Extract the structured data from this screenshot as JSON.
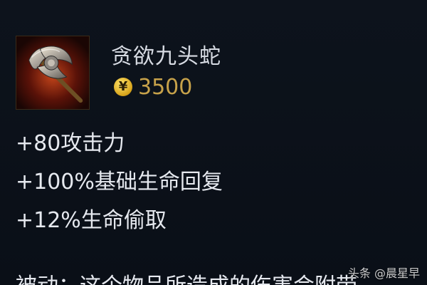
{
  "item": {
    "name": "贪欲九头蛇",
    "cost": "3500",
    "gold_icon_symbol": "¥",
    "icon": "hydra-axe-icon",
    "icon_bg_color": "#6b1a0c"
  },
  "stats": [
    "+80攻击力",
    "+100%基础生命回复",
    "+12%生命偷取"
  ],
  "passive_partial": "被动：这个物品所造成的伤害会附带",
  "watermark": "头条 @晨星早",
  "colors": {
    "name_text": "#d7dbe3",
    "cost_text": "#c7a24a",
    "stat_text": "#e6e9ef",
    "background": "#0b1018"
  }
}
